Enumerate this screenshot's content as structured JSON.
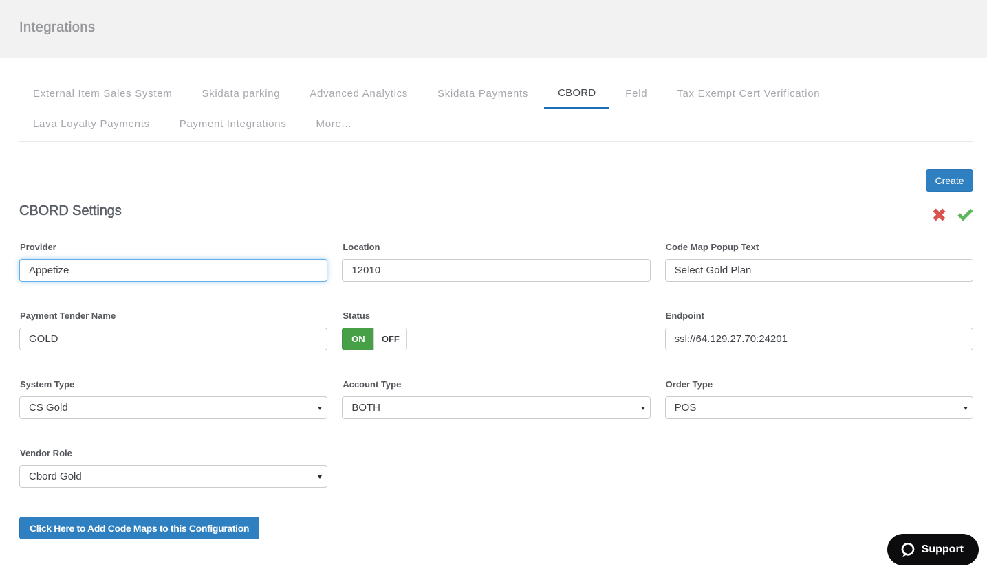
{
  "header": {
    "title": "Integrations"
  },
  "tabs": {
    "items": [
      {
        "label": "External Item Sales System",
        "active": false
      },
      {
        "label": "Skidata parking",
        "active": false
      },
      {
        "label": "Advanced Analytics",
        "active": false
      },
      {
        "label": "Skidata Payments",
        "active": false
      },
      {
        "label": "CBORD",
        "active": true
      },
      {
        "label": "Feld",
        "active": false
      },
      {
        "label": "Tax Exempt Cert Verification",
        "active": false
      },
      {
        "label": "Lava Loyalty Payments",
        "active": false
      },
      {
        "label": "Payment Integrations",
        "active": false
      },
      {
        "label": "More...",
        "active": false
      }
    ]
  },
  "actions": {
    "create_label": "Create"
  },
  "settings": {
    "title": "CBORD Settings"
  },
  "form": {
    "provider": {
      "label": "Provider",
      "value": "Appetize",
      "focused": true
    },
    "location": {
      "label": "Location",
      "value": "12010"
    },
    "code_map_popup_text": {
      "label": "Code Map Popup Text",
      "value": "Select Gold Plan"
    },
    "payment_tender_name": {
      "label": "Payment Tender Name",
      "value": "GOLD"
    },
    "status": {
      "label": "Status",
      "on_label": "ON",
      "off_label": "OFF",
      "value": "ON"
    },
    "endpoint": {
      "label": "Endpoint",
      "value": "ssl://64.129.27.70:24201"
    },
    "system_type": {
      "label": "System Type",
      "value": "CS Gold"
    },
    "account_type": {
      "label": "Account Type",
      "value": "BOTH"
    },
    "order_type": {
      "label": "Order Type",
      "value": "POS"
    },
    "vendor_role": {
      "label": "Vendor Role",
      "value": "Cbord Gold"
    }
  },
  "buttons": {
    "add_code_maps": "Click Here to Add Code Maps to this Configuration"
  },
  "support": {
    "label": "Support"
  },
  "colors": {
    "header_bg": "#f2f2f2",
    "accent_blue": "#2e80c1",
    "tab_underline": "#1b6fb5",
    "toggle_on_green": "#47a045",
    "cancel_red": "#d9534f",
    "confirm_green": "#5cb85c",
    "support_bg": "#0c0c0e"
  }
}
